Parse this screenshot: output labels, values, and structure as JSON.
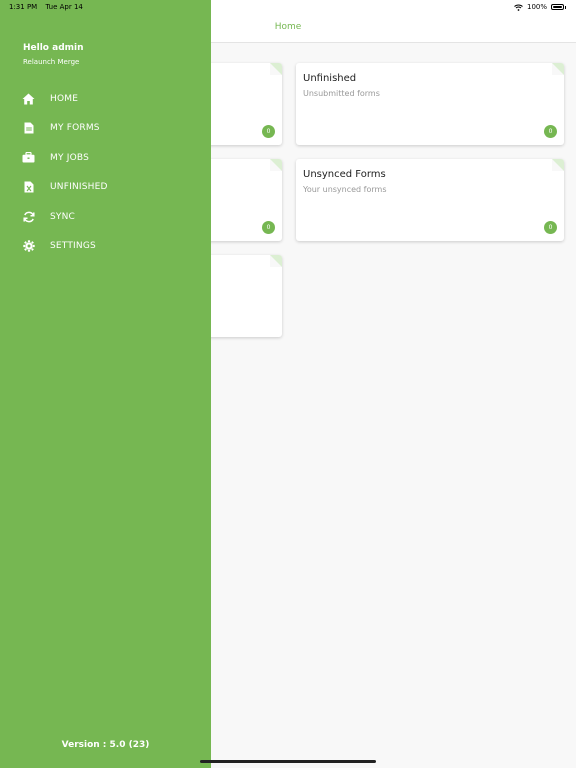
{
  "status": {
    "time": "1:31 PM",
    "date": "Tue Apr 14",
    "battery": "100%"
  },
  "header": {
    "title": "Home"
  },
  "cards": [
    {
      "title": "",
      "subtitle": "",
      "count": "0"
    },
    {
      "title": "Unfinished",
      "subtitle": "Unsubmitted forms",
      "count": "0"
    },
    {
      "title": "",
      "subtitle": "",
      "count": "0"
    },
    {
      "title": "Unsynced Forms",
      "subtitle": "Your unsynced forms",
      "count": "0"
    },
    {
      "title": "",
      "subtitle": ""
    }
  ],
  "drawer": {
    "greeting": "Hello admin",
    "subtitle": "Relaunch Merge",
    "items": [
      {
        "label": "HOME",
        "icon": "home-icon"
      },
      {
        "label": "MY FORMS",
        "icon": "document-icon"
      },
      {
        "label": "MY JOBS",
        "icon": "briefcase-icon"
      },
      {
        "label": "UNFINISHED",
        "icon": "excel-file-icon"
      },
      {
        "label": "SYNC",
        "icon": "sync-icon"
      },
      {
        "label": "SETTINGS",
        "icon": "gear-icon"
      }
    ],
    "version": "Version : 5.0 (23)"
  },
  "colors": {
    "accent": "#76b752",
    "background": "#f8f8f8"
  }
}
